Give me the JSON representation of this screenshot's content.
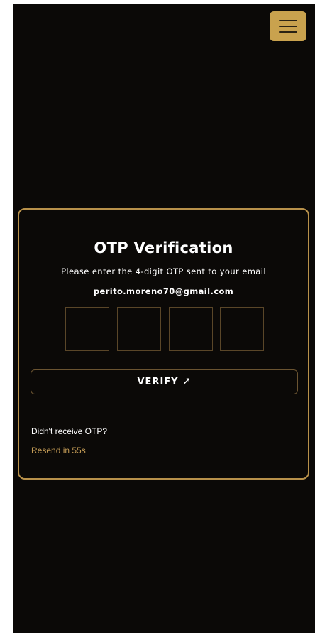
{
  "header": {
    "menu_icon": "hamburger-menu-icon"
  },
  "otp_card": {
    "title": "OTP Verification",
    "instruction": "Please enter the 4-digit OTP sent to your email",
    "email": "perito.moreno70@gmail.com",
    "digits": [
      "",
      "",
      "",
      ""
    ],
    "verify_label": "VERIFY",
    "verify_icon": "arrow-up-right-icon",
    "no_otp_text": "Didn't receive OTP?",
    "resend_text": "Resend in 55s"
  },
  "colors": {
    "background": "#0b0907",
    "accent": "#c9a24e",
    "border": "#b8914a",
    "resend": "#c29a55"
  }
}
